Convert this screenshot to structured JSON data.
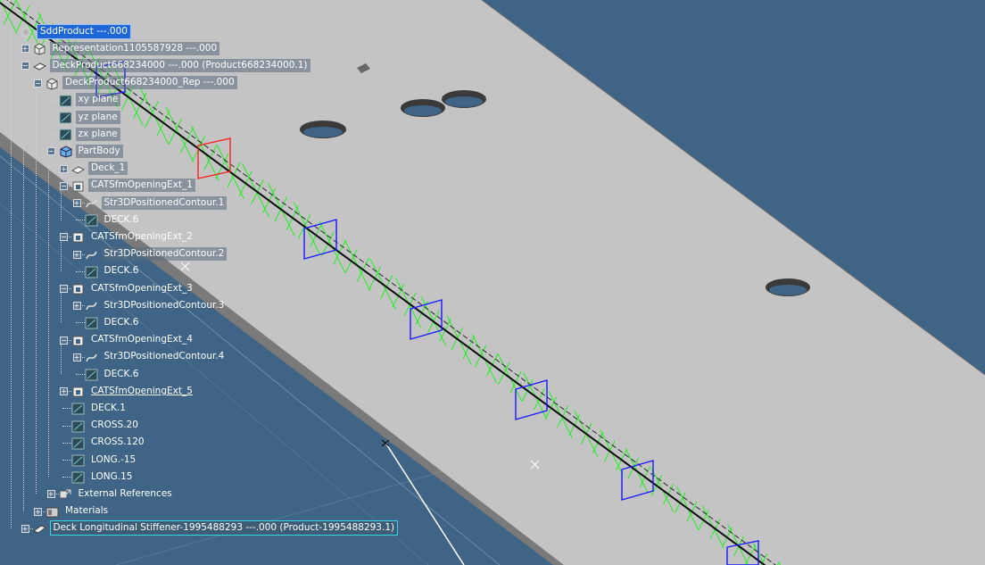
{
  "tree": {
    "items": [
      {
        "label": "SddProduct ---.000",
        "depth": 0,
        "icon": "product-icon",
        "expander": "none",
        "style": "sel"
      },
      {
        "label": "Representation1105587928 ---.000",
        "depth": 1,
        "icon": "representation-icon",
        "expander": "+",
        "style": "box"
      },
      {
        "label": "DeckProduct668234000 ---.000 (Product668234000.1)",
        "depth": 1,
        "icon": "deck-product-icon",
        "expander": "-",
        "style": "box"
      },
      {
        "label": "DeckProduct668234000_Rep ---.000",
        "depth": 2,
        "icon": "representation-icon",
        "expander": "-",
        "style": "box"
      },
      {
        "label": "xy plane",
        "depth": 3,
        "icon": "plane-icon",
        "expander": "none",
        "style": "box"
      },
      {
        "label": "yz plane",
        "depth": 3,
        "icon": "plane-icon",
        "expander": "none",
        "style": "box"
      },
      {
        "label": "zx plane",
        "depth": 3,
        "icon": "plane-icon",
        "expander": "none",
        "style": "box"
      },
      {
        "label": "PartBody",
        "depth": 3,
        "icon": "partbody-icon",
        "expander": "-",
        "style": "box"
      },
      {
        "label": "Deck_1",
        "depth": 4,
        "icon": "deck-icon",
        "expander": "+",
        "style": "box"
      },
      {
        "label": "CATSfmOpeningExt_1",
        "depth": 4,
        "icon": "opening-icon",
        "expander": "-",
        "style": "box"
      },
      {
        "label": "Str3DPositionedContour.1",
        "depth": 5,
        "icon": "contour-icon",
        "expander": "+",
        "style": "box"
      },
      {
        "label": "DECK.6",
        "depth": 5,
        "icon": "plane-icon",
        "expander": "none",
        "style": "plain"
      },
      {
        "label": "CATSfmOpeningExt_2",
        "depth": 4,
        "icon": "opening-icon",
        "expander": "-",
        "style": "plain"
      },
      {
        "label": "Str3DPositionedContour.2",
        "depth": 5,
        "icon": "contour-icon",
        "expander": "+",
        "style": "box"
      },
      {
        "label": "DECK.6",
        "depth": 5,
        "icon": "plane-icon",
        "expander": "none",
        "style": "plain"
      },
      {
        "label": "CATSfmOpeningExt_3",
        "depth": 4,
        "icon": "opening-icon",
        "expander": "-",
        "style": "plain"
      },
      {
        "label": "Str3DPositionedContour.3",
        "depth": 5,
        "icon": "contour-icon",
        "expander": "+",
        "style": "plain"
      },
      {
        "label": "DECK.6",
        "depth": 5,
        "icon": "plane-icon",
        "expander": "none",
        "style": "plain"
      },
      {
        "label": "CATSfmOpeningExt_4",
        "depth": 4,
        "icon": "opening-icon",
        "expander": "-",
        "style": "plain"
      },
      {
        "label": "Str3DPositionedContour.4",
        "depth": 5,
        "icon": "contour-icon",
        "expander": "+",
        "style": "plain"
      },
      {
        "label": "DECK.6",
        "depth": 5,
        "icon": "plane-icon",
        "expander": "none",
        "style": "plain"
      },
      {
        "label": "CATSfmOpeningExt_5",
        "depth": 4,
        "icon": "opening-icon",
        "expander": "+",
        "style": "u"
      },
      {
        "label": "DECK.1",
        "depth": 4,
        "icon": "plane-icon",
        "expander": "none",
        "style": "plain"
      },
      {
        "label": "CROSS.20",
        "depth": 4,
        "icon": "plane-icon",
        "expander": "none",
        "style": "plain"
      },
      {
        "label": "CROSS.120",
        "depth": 4,
        "icon": "plane-icon",
        "expander": "none",
        "style": "plain"
      },
      {
        "label": "LONG.-15",
        "depth": 4,
        "icon": "plane-icon",
        "expander": "none",
        "style": "plain"
      },
      {
        "label": "LONG.15",
        "depth": 4,
        "icon": "plane-icon",
        "expander": "none",
        "style": "plain"
      },
      {
        "label": "External References",
        "depth": 3,
        "icon": "external-references-icon",
        "expander": "+",
        "style": "plain"
      },
      {
        "label": "Materials",
        "depth": 2,
        "icon": "materials-icon",
        "expander": "+",
        "style": "plain"
      },
      {
        "label": "Deck Longitudinal Stiffener-1995488293 ---.000 (Product-1995488293.1)",
        "depth": 1,
        "icon": "stiffener-icon",
        "expander": "+",
        "style": "cyan"
      }
    ]
  },
  "colors": {
    "background": "#3f6485",
    "deck_surface": "#c4c4c4",
    "deck_edge": "#8a8a8a",
    "pattern_green": "#22ee22",
    "frame_blue": "#1a1aff",
    "frame_red": "#ff2020",
    "selection": "#1f66d6"
  }
}
